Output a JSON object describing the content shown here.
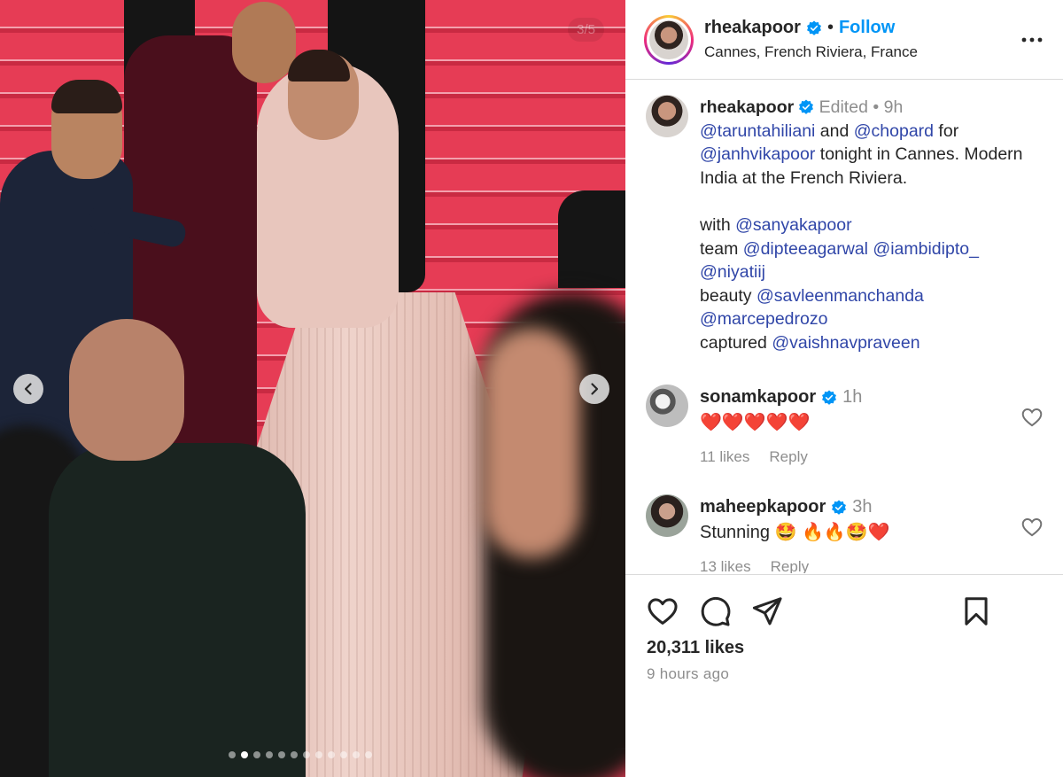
{
  "media": {
    "counter": "3/5",
    "total_dots": 12,
    "active_dot": 2,
    "accent_color": "#e63c55"
  },
  "header": {
    "username": "rheakapoor",
    "separator": "•",
    "follow_label": "Follow",
    "location": "Cannes, French Riviera, France"
  },
  "caption": {
    "username": "rheakapoor",
    "edited": "Edited",
    "dot": "•",
    "age": "9h",
    "lines": {
      "l1_m1": "@taruntahiliani",
      "l1_and": " and ",
      "l1_m2": "@chopard",
      "l1_for": " for",
      "l2_m": "@janhvikapoor",
      "l2_text": " tonight in Cannes. Modern",
      "l3_text": "India at the French Riviera.",
      "with_label": "with ",
      "with_m": "@sanyakapoor",
      "team_label": "team ",
      "team_m1": "@dipteeagarwal",
      "team_m2": " @iambidipto_",
      "team_m3": "@niyatiij",
      "beauty_label": "beauty ",
      "beauty_m1": "@savleenmanchanda",
      "beauty_m2": "@marcepedrozo",
      "captured_label": "captured ",
      "captured_m": "@vaishnavpraveen"
    }
  },
  "comments": [
    {
      "username": "sonamkapoor",
      "age": "1h",
      "text": "❤️❤️❤️❤️❤️",
      "likes": "11 likes",
      "reply": "Reply"
    },
    {
      "username": "maheepkapoor",
      "age": "3h",
      "text": "Stunning 🤩 🔥🔥🤩❤️",
      "likes": "13 likes",
      "reply": "Reply"
    }
  ],
  "footer": {
    "likes": "20,311 likes",
    "time": "9 hours ago"
  },
  "icons": {
    "verified": "verified-badge-icon",
    "more": "more-options-icon",
    "like": "heart-icon",
    "comment": "comment-icon",
    "share": "share-icon",
    "save": "bookmark-icon",
    "prev": "chevron-left-icon",
    "next": "chevron-right-icon"
  },
  "colors": {
    "link": "#0095f6",
    "mention": "#3046a8",
    "muted": "#8e8e8e",
    "verified": "#0095f6"
  }
}
